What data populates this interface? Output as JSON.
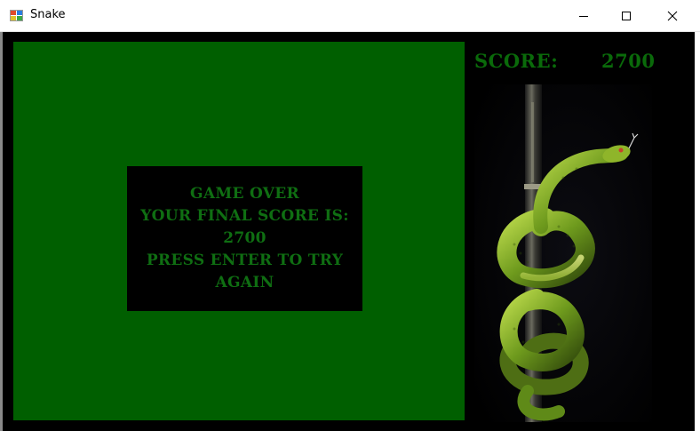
{
  "window": {
    "title": "Snake",
    "icons": {
      "app": "app-icon",
      "minimize": "minimize-icon",
      "maximize": "maximize-icon",
      "close": "close-icon"
    }
  },
  "game": {
    "board_color": "#005f00",
    "text_color": "#0f6e12",
    "score_label": "SCORE:",
    "score_value": "2700",
    "game_over": {
      "line1": "GAME OVER",
      "line2": "YOUR FINAL SCORE IS:",
      "line3": "2700",
      "line4": "PRESS ENTER TO TRY",
      "line5": "AGAIN"
    },
    "side_image": "green-snake-on-pole-image"
  }
}
